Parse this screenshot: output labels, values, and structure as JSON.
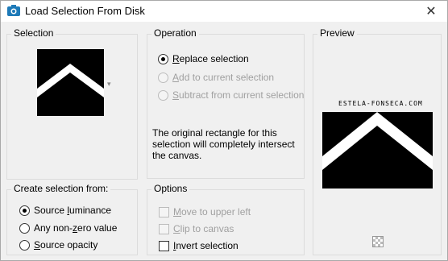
{
  "window": {
    "title": "Load Selection From Disk",
    "close_glyph": "✕"
  },
  "selection_group": {
    "label": "Selection",
    "dropdown_glyph": "▾"
  },
  "operation_group": {
    "label": "Operation",
    "options": [
      {
        "label_access": "R",
        "label_rest": "eplace selection",
        "checked": true,
        "enabled": true
      },
      {
        "label_access": "A",
        "label_rest": "dd to current selection",
        "checked": false,
        "enabled": false
      },
      {
        "label_access": "S",
        "label_rest": "ubtract from current selection",
        "checked": false,
        "enabled": false
      }
    ],
    "note_line1": "The original rectangle for this",
    "note_line2": "selection will completely intersect",
    "note_line3": "the canvas."
  },
  "preview_group": {
    "label": "Preview",
    "caption": "ESTELA-FONSECA.COM"
  },
  "create_group": {
    "label": "Create selection from:",
    "options": [
      {
        "label_pre": "Source ",
        "label_access": "l",
        "label_rest": "uminance",
        "checked": true
      },
      {
        "label_pre": "Any non-",
        "label_access": "z",
        "label_rest": "ero value",
        "checked": false
      },
      {
        "label_pre": "",
        "label_access": "S",
        "label_rest": "ource opacity",
        "checked": false
      }
    ]
  },
  "options_group": {
    "label": "Options",
    "items": [
      {
        "label_access": "M",
        "label_rest": "ove to upper left",
        "checked": false,
        "enabled": false
      },
      {
        "label_access": "C",
        "label_rest": "lip to canvas",
        "checked": false,
        "enabled": false
      },
      {
        "label_access": "I",
        "label_rest": "nvert selection",
        "checked": false,
        "enabled": true
      }
    ]
  },
  "colors": {
    "accent": "#1e7ab8",
    "thumb_fill": "#000000",
    "thumb_band": "#ffffff"
  },
  "icons": {
    "app": "camera-icon",
    "close": "close-icon",
    "checker": "transparency-checker-icon"
  }
}
